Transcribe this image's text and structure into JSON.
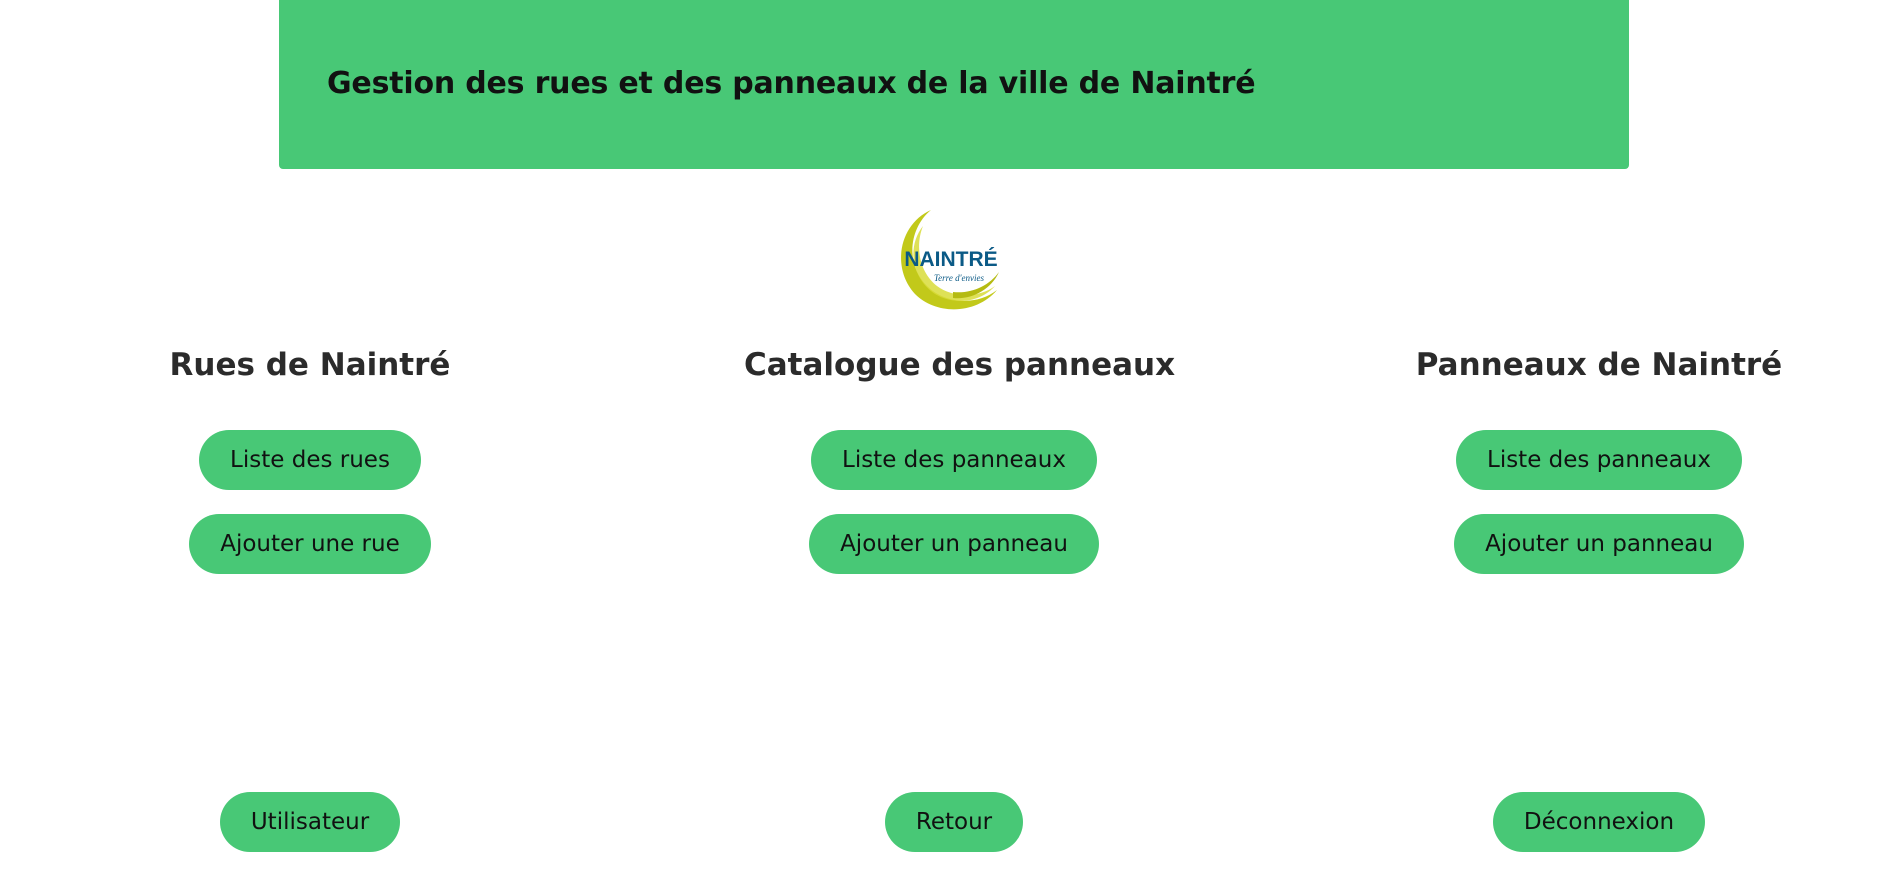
{
  "header": {
    "title": "Gestion des rues et des panneaux de la ville de Naintré"
  },
  "logo": {
    "text": "NAINTRÉ",
    "tagline": "Terre d'envies"
  },
  "columns": {
    "rues": {
      "heading": "Rues de Naintré",
      "list_label": "Liste des rues",
      "add_label": "Ajouter une rue"
    },
    "catalogue": {
      "heading": "Catalogue des panneaux",
      "list_label": "Liste des panneaux",
      "add_label": "Ajouter un panneau"
    },
    "panneaux": {
      "heading": "Panneaux de Naintré",
      "list_label": "Liste des panneaux",
      "add_label": "Ajouter un panneau"
    }
  },
  "footer": {
    "user_label": "Utilisateur",
    "back_label": "Retour",
    "logout_label": "Déconnexion"
  },
  "colors": {
    "accent": "#48c876",
    "logo_yellow": "#c2c91a",
    "logo_blue": "#0b5a86"
  }
}
